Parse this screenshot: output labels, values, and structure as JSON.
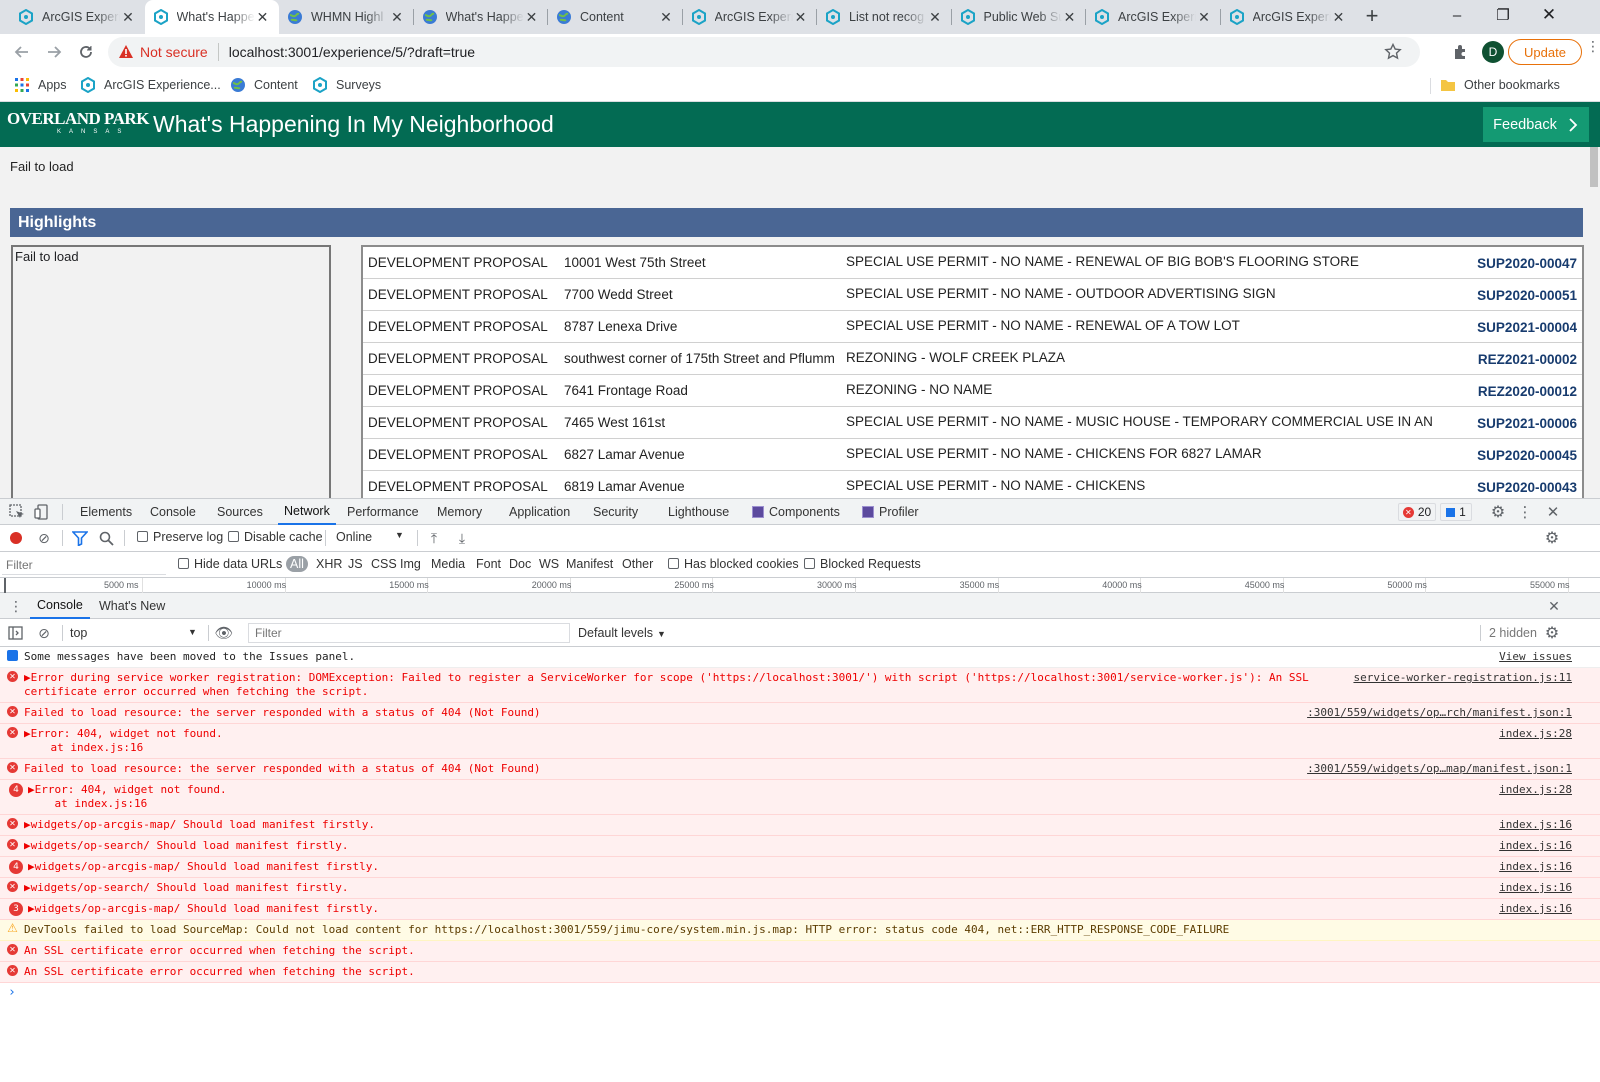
{
  "browser": {
    "tabs": [
      {
        "label": "ArcGIS Experie",
        "icon": "arcgis-experience-icon"
      },
      {
        "label": "What's Happe",
        "icon": "arcgis-experience-icon",
        "active": true
      },
      {
        "label": "WHMN Highl",
        "icon": "globe-icon"
      },
      {
        "label": "What's Happe",
        "icon": "globe-icon"
      },
      {
        "label": "Content",
        "icon": "globe-icon"
      },
      {
        "label": "ArcGIS Experi",
        "icon": "arcgis-experience-icon"
      },
      {
        "label": "List not recog",
        "icon": "arcgis-experience-icon"
      },
      {
        "label": "Public Web Su",
        "icon": "arcgis-experience-icon"
      },
      {
        "label": "ArcGIS Experi",
        "icon": "arcgis-experience-icon"
      },
      {
        "label": "ArcGIS Experi",
        "icon": "arcgis-experience-icon"
      }
    ],
    "close_glyph": "✕",
    "new_tab": "+",
    "security_label": "Not secure",
    "url": "localhost:3001/experience/5/?draft=true",
    "profile_initial": "D",
    "update_label": "Update",
    "bookmarks": {
      "apps": "Apps",
      "items": [
        "ArcGIS Experience...",
        "Content",
        "Surveys"
      ],
      "other": "Other bookmarks"
    }
  },
  "app": {
    "logo_main": "OVERLAND PARK",
    "logo_sub": "KANSAS",
    "title": "What's Happening In My Neighborhood",
    "feedback_label": "Feedback",
    "fail_top": "Fail to load",
    "highlights_title": "Highlights",
    "fail_left": "Fail to load",
    "projects": [
      {
        "type": "DEVELOPMENT PROPOSAL",
        "address": "10001 West 75th Street",
        "description": "SPECIAL USE PERMIT - NO NAME - RENEWAL OF BIG BOB'S FLOORING STORE",
        "case": "SUP2020-00047"
      },
      {
        "type": "DEVELOPMENT PROPOSAL",
        "address": "7700 Wedd Street",
        "description": "SPECIAL USE PERMIT - NO NAME - OUTDOOR ADVERTISING SIGN",
        "case": "SUP2020-00051"
      },
      {
        "type": "DEVELOPMENT PROPOSAL",
        "address": "8787 Lenexa Drive",
        "description": "SPECIAL USE PERMIT - NO NAME - RENEWAL OF A TOW LOT",
        "case": "SUP2021-00004"
      },
      {
        "type": "DEVELOPMENT PROPOSAL",
        "address": "southwest corner of 175th Street and Pflumm",
        "description": "REZONING - WOLF CREEK PLAZA",
        "case": "REZ2021-00002"
      },
      {
        "type": "DEVELOPMENT PROPOSAL",
        "address": "7641 Frontage Road",
        "description": "REZONING - NO NAME",
        "case": "REZ2020-00012"
      },
      {
        "type": "DEVELOPMENT PROPOSAL",
        "address": "7465 West 161st",
        "description": "SPECIAL USE PERMIT - NO NAME - MUSIC HOUSE - TEMPORARY COMMERCIAL USE IN AN",
        "case": "SUP2021-00006"
      },
      {
        "type": "DEVELOPMENT PROPOSAL",
        "address": "6827 Lamar Avenue",
        "description": "SPECIAL USE PERMIT - NO NAME - CHICKENS FOR 6827 LAMAR",
        "case": "SUP2020-00045"
      },
      {
        "type": "DEVELOPMENT PROPOSAL",
        "address": "6819 Lamar Avenue",
        "description": "SPECIAL USE PERMIT - NO NAME - CHICKENS",
        "case": "SUP2020-00043"
      }
    ]
  },
  "devtools": {
    "tabs": [
      "Elements",
      "Console",
      "Sources",
      "Network",
      "Performance",
      "Memory",
      "Application",
      "Security",
      "Lighthouse",
      "Components",
      "Profiler"
    ],
    "active_tab": "Network",
    "error_count": "20",
    "issue_count": "1",
    "network": {
      "preserve_log": "Preserve log",
      "disable_cache": "Disable cache",
      "throttle": "Online",
      "filter_placeholder": "Filter",
      "hide_data_urls": "Hide data URLs",
      "types": [
        "All",
        "XHR",
        "JS",
        "CSS",
        "Img",
        "Media",
        "Font",
        "Doc",
        "WS",
        "Manifest",
        "Other"
      ],
      "has_blocked_cookies": "Has blocked cookies",
      "blocked_requests": "Blocked Requests",
      "ruler": [
        "5000 ms",
        "10000 ms",
        "15000 ms",
        "20000 ms",
        "25000 ms",
        "30000 ms",
        "35000 ms",
        "40000 ms",
        "45000 ms",
        "50000 ms",
        "55000 ms"
      ]
    },
    "drawer": {
      "tabs": [
        "Console",
        "What's New"
      ],
      "context": "top",
      "filter_placeholder": "Filter",
      "levels": "Default levels",
      "hidden": "2 hidden"
    },
    "messages": [
      {
        "level": "info",
        "text": "Some messages have been moved to the Issues panel.",
        "source": "View issues"
      },
      {
        "level": "error",
        "text": "▶Error during service worker registration: DOMException: Failed to register a ServiceWorker for scope ('https://localhost:3001/') with script ('https://localhost:3001/service-worker.js'): An SSL",
        "text2": "certificate error occurred when fetching the script.",
        "source": "service-worker-registration.js:11"
      },
      {
        "level": "error",
        "text": "Failed to load resource: the server responded with a status of 404 (Not Found)",
        "source": ":3001/559/widgets/op…rch/manifest.json:1"
      },
      {
        "level": "error",
        "text": "▶Error: 404, widget not found.",
        "text2": "    at index.js:16",
        "source": "index.js:28"
      },
      {
        "level": "error",
        "text": "Failed to load resource: the server responded with a status of 404 (Not Found)",
        "source": ":3001/559/widgets/op…map/manifest.json:1"
      },
      {
        "level": "error",
        "count": "4",
        "text": "▶Error: 404, widget not found.",
        "text2": "    at index.js:16",
        "source": "index.js:28"
      },
      {
        "level": "error",
        "text": "▶widgets/op-arcgis-map/ Should load manifest firstly.",
        "source": "index.js:16"
      },
      {
        "level": "error",
        "text": "▶widgets/op-search/ Should load manifest firstly.",
        "source": "index.js:16"
      },
      {
        "level": "error",
        "count": "4",
        "text": "▶widgets/op-arcgis-map/ Should load manifest firstly.",
        "source": "index.js:16"
      },
      {
        "level": "error",
        "text": "▶widgets/op-search/ Should load manifest firstly.",
        "source": "index.js:16"
      },
      {
        "level": "error",
        "count": "3",
        "text": "▶widgets/op-arcgis-map/ Should load manifest firstly.",
        "source": "index.js:16"
      },
      {
        "level": "warn",
        "text": "DevTools failed to load SourceMap: Could not load content for https://localhost:3001/559/jimu-core/system.min.js.map: HTTP error: status code 404, net::ERR_HTTP_RESPONSE_CODE_FAILURE",
        "source": ""
      },
      {
        "level": "error",
        "text": "An SSL certificate error occurred when fetching the script.",
        "source": ""
      },
      {
        "level": "error",
        "text": "An SSL certificate error occurred when fetching the script.",
        "source": ""
      }
    ],
    "prompt": "›"
  },
  "colors": {
    "app_header": "#036b53",
    "feedback": "#149a73",
    "highlights": "#4a6694",
    "case_link": "#173b6e",
    "error_text": "#e00000",
    "error_bg": "#fff0f0"
  }
}
